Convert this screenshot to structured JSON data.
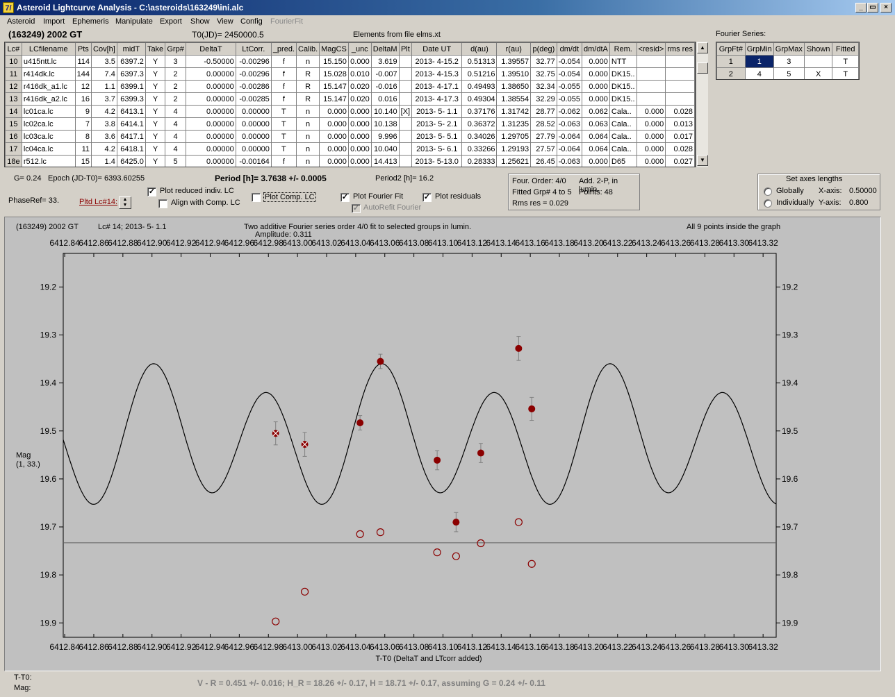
{
  "window": {
    "icon_glyph": "7/",
    "title": "Asteroid Lightcurve Analysis - C:\\asteroids\\163249\\ini.alc",
    "min_glyph": "_",
    "max_glyph": "▭",
    "close_glyph": "×"
  },
  "menu": [
    "Asteroid",
    "Import",
    "Ephemeris",
    "Manipulate",
    "Export",
    "Show",
    "View",
    "Config",
    "FourierFit"
  ],
  "header": {
    "object": "(163249) 2002 GT",
    "t0": "T0(JD)= 2450000.5",
    "elements": "Elements from file elms.xt",
    "fourier_title": "Fourier Series:"
  },
  "lc_table": {
    "columns": [
      "Lc#",
      "LCfilename",
      "Pts",
      "Cov[h]",
      "midT",
      "Take",
      "Grp#",
      "DeltaT",
      "LtCorr.",
      "_pred.",
      "Calib.",
      "MagCS",
      "_unc",
      "DeltaM",
      "Plt",
      "Date UT",
      "d(au)",
      "r(au)",
      "p(deg)",
      "dm/dt",
      "dm/dtA",
      "Rem.",
      "<resid>",
      "rms res"
    ],
    "rows": [
      [
        "10",
        "u415ntt.lc",
        "114",
        "3.5",
        "6397.2",
        "Y",
        "3",
        "-0.50000",
        "-0.00296",
        "f",
        "n",
        "15.150",
        "0.000",
        "3.619",
        "",
        "2013- 4-15.2",
        "0.51313",
        "1.39557",
        "32.77",
        "-0.054",
        "0.000",
        "NTT",
        "",
        ""
      ],
      [
        "11",
        "r414dk.lc",
        "144",
        "7.4",
        "6397.3",
        "Y",
        "2",
        "0.00000",
        "-0.00296",
        "f",
        "R",
        "15.028",
        "0.010",
        "-0.007",
        "",
        "2013- 4-15.3",
        "0.51216",
        "1.39510",
        "32.75",
        "-0.054",
        "0.000",
        "DK15..",
        "",
        ""
      ],
      [
        "12",
        "r416dk_a1.lc",
        "12",
        "1.1",
        "6399.1",
        "Y",
        "2",
        "0.00000",
        "-0.00286",
        "f",
        "R",
        "15.147",
        "0.020",
        "-0.016",
        "",
        "2013- 4-17.1",
        "0.49493",
        "1.38650",
        "32.34",
        "-0.055",
        "0.000",
        "DK15..",
        "",
        ""
      ],
      [
        "13",
        "r416dk_a2.lc",
        "16",
        "3.7",
        "6399.3",
        "Y",
        "2",
        "0.00000",
        "-0.00285",
        "f",
        "R",
        "15.147",
        "0.020",
        "0.016",
        "",
        "2013- 4-17.3",
        "0.49304",
        "1.38554",
        "32.29",
        "-0.055",
        "0.000",
        "DK15..",
        "",
        ""
      ],
      [
        "14",
        "lc01ca.lc",
        "9",
        "4.2",
        "6413.1",
        "Y",
        "4",
        "0.00000",
        "0.00000",
        "T",
        "n",
        "0.000",
        "0.000",
        "10.140",
        "[X]",
        "2013- 5- 1.1",
        "0.37176",
        "1.31742",
        "28.77",
        "-0.062",
        "0.062",
        "Cala..",
        "0.000",
        "0.028"
      ],
      [
        "15",
        "lc02ca.lc",
        "7",
        "3.8",
        "6414.1",
        "Y",
        "4",
        "0.00000",
        "0.00000",
        "T",
        "n",
        "0.000",
        "0.000",
        "10.138",
        "",
        "2013- 5- 2.1",
        "0.36372",
        "1.31235",
        "28.52",
        "-0.063",
        "0.063",
        "Cala..",
        "0.000",
        "0.013"
      ],
      [
        "16",
        "lc03ca.lc",
        "8",
        "3.6",
        "6417.1",
        "Y",
        "4",
        "0.00000",
        "0.00000",
        "T",
        "n",
        "0.000",
        "0.000",
        "9.996",
        "",
        "2013- 5- 5.1",
        "0.34026",
        "1.29705",
        "27.79",
        "-0.064",
        "0.064",
        "Cala..",
        "0.000",
        "0.017"
      ],
      [
        "17",
        "lc04ca.lc",
        "11",
        "4.2",
        "6418.1",
        "Y",
        "4",
        "0.00000",
        "0.00000",
        "T",
        "n",
        "0.000",
        "0.000",
        "10.040",
        "",
        "2013- 5- 6.1",
        "0.33266",
        "1.29193",
        "27.57",
        "-0.064",
        "0.064",
        "Cala..",
        "0.000",
        "0.028"
      ],
      [
        "18e",
        "r512.lc",
        "15",
        "1.4",
        "6425.0",
        "Y",
        "5",
        "0.00000",
        "-0.00164",
        "f",
        "n",
        "0.000",
        "0.000",
        "14.413",
        "",
        "2013- 5-13.0",
        "0.28333",
        "1.25621",
        "26.45",
        "-0.063",
        "0.000",
        "D65",
        "0.000",
        "0.027"
      ]
    ]
  },
  "fourier_table": {
    "columns": [
      "GrpFt#",
      "GrpMin",
      "GrpMax",
      "Shown",
      "Fitted"
    ],
    "rows": [
      [
        "1",
        "1",
        "3",
        "",
        "T"
      ],
      [
        "2",
        "4",
        "5",
        "X",
        "T"
      ]
    ]
  },
  "info": {
    "g": "G= 0.24",
    "epoch": "Epoch (JD-T0)= 6393.60255",
    "period": "Period [h]= 3.7638 +/- 0.0005",
    "period2": "Period2 [h]= 16.2",
    "phaseref": "PhaseRef= 33.",
    "pltd_lc": "Pltd Lc#14:",
    "plot_reduced": "Plot reduced indiv. LC",
    "align_comp": "Align with Comp. LC",
    "plot_comp": "Plot Comp. LC",
    "plot_fourier": "Plot Fourier Fit",
    "autorefit": "AutoRefit Fourier",
    "plot_residuals": "Plot residuals",
    "four_order": "Four. Order:  4/0",
    "add": "Add. 2-P, in lumin.",
    "fitted": "Fitted Grp# 4 to 5",
    "points": "Points: 48",
    "rms": "Rms res     = 0.029",
    "check": "✓"
  },
  "axes_box": {
    "title": "Set axes lengths",
    "globally": "Globally",
    "individually": "Individually",
    "xaxis_label": "X-axis:",
    "xaxis_value": "0.50000",
    "yaxis_label": "Y-axis:",
    "yaxis_value": "0.800"
  },
  "plot": {
    "object": "(163249) 2002 GT",
    "lc_info": "Lc# 14; 2013- 5- 1.1",
    "fit_title": "Two additive Fourier series order 4/0 fit to selected groups in lumin.",
    "amplitude": "Amplitude: 0.311",
    "inside": "All 9 points inside the graph",
    "ylabel": "Mag",
    "ylabel2": "(1, 33.)",
    "xlabel": "T-T0 (DeltaT and LTcorr added)",
    "bg": "#c0c0c0",
    "point_color": "#8b0000"
  },
  "footer": {
    "tt0": "T-T0:",
    "mag": "Mag:",
    "result": "V - R = 0.451 +/- 0.016; H_R = 18.26 +/- 0.17, H = 18.71 +/- 0.17, assuming G = 0.24 +/- 0.11"
  },
  "chart_data": {
    "type": "scatter",
    "title": "Two additive Fourier series order 4/0 fit to selected groups in lumin.",
    "xlabel": "T-T0 (DeltaT and LTcorr added)",
    "ylabel": "Mag",
    "xlim": [
      6412.83,
      6413.33
    ],
    "ylim": [
      19.93,
      19.13
    ],
    "x_ticks": [
      6412.84,
      6412.86,
      6412.88,
      6412.9,
      6412.92,
      6412.94,
      6412.96,
      6412.98,
      6413.0,
      6413.02,
      6413.04,
      6413.06,
      6413.08,
      6413.1,
      6413.12,
      6413.14,
      6413.16,
      6413.18,
      6413.2,
      6413.22,
      6413.24,
      6413.26,
      6413.28,
      6413.3,
      6413.32
    ],
    "y_ticks": [
      19.2,
      19.3,
      19.4,
      19.5,
      19.6,
      19.7,
      19.8,
      19.9
    ],
    "series": [
      {
        "x": [
          6412.985,
          6413.005,
          6413.043,
          6413.057,
          6413.096,
          6413.109,
          6413.126,
          6413.152,
          6413.161
        ],
        "y": [
          19.505,
          19.528,
          19.483,
          19.355,
          19.561,
          19.69,
          19.546,
          19.328,
          19.454
        ],
        "err": [
          0.024,
          0.025,
          0.015,
          0.015,
          0.02,
          0.02,
          0.02,
          0.025,
          0.024
        ],
        "excluded": [
          true,
          true,
          false,
          false,
          false,
          false,
          false,
          false,
          false
        ]
      },
      {
        "x": [
          6412.985,
          6413.005,
          6413.043,
          6413.057,
          6413.096,
          6413.109,
          6413.126,
          6413.152,
          6413.161
        ],
        "y": [
          19.897,
          19.835,
          19.715,
          19.711,
          19.753,
          19.761,
          19.734,
          19.69,
          19.777
        ]
      }
    ],
    "reference_line_y": 19.733,
    "period_h": 3.7638,
    "amplitude": 0.311
  }
}
